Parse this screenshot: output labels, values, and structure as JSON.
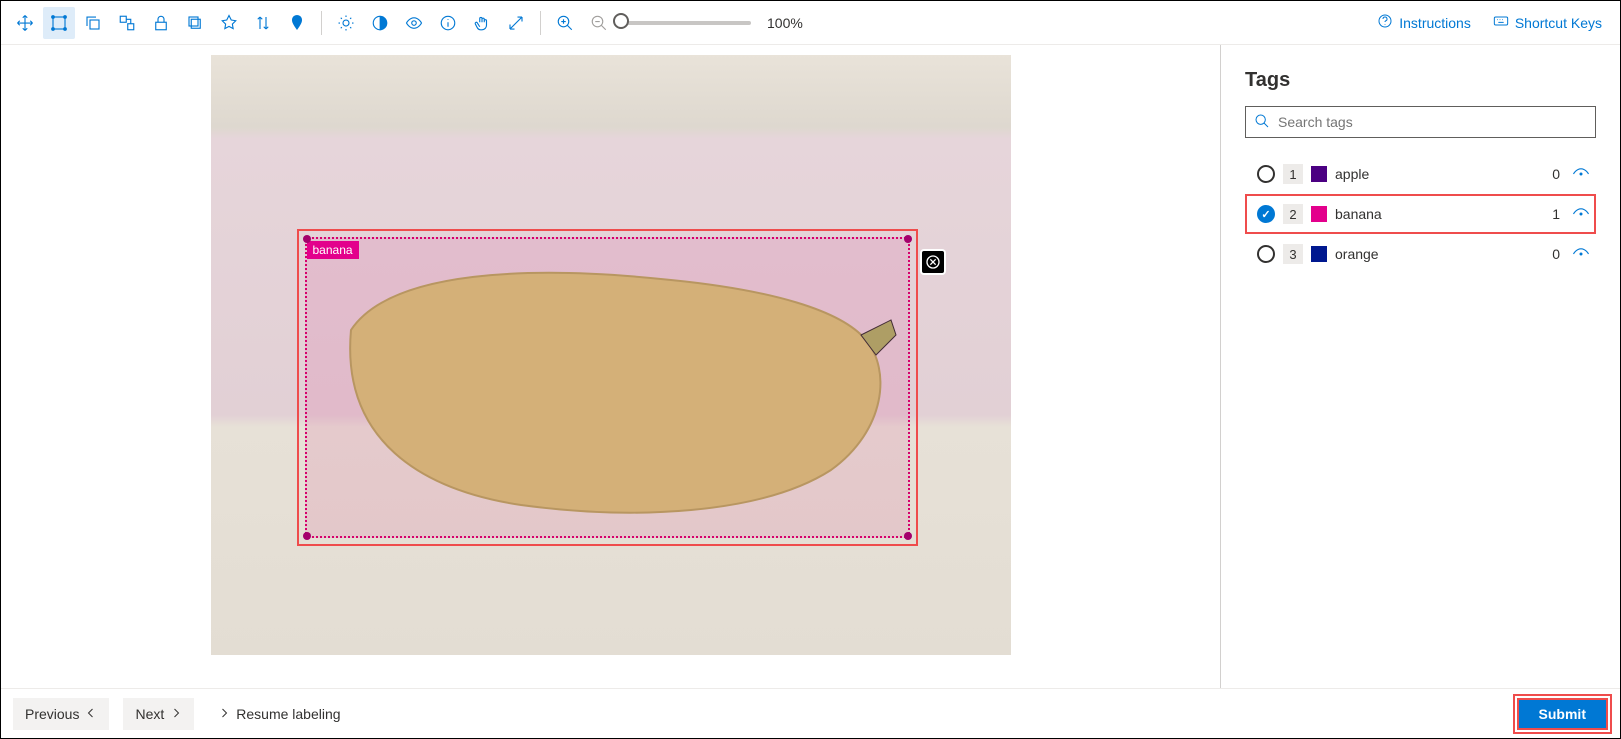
{
  "toolbar": {
    "zoom_level": "100%",
    "instructions_label": "Instructions",
    "shortcut_keys_label": "Shortcut Keys"
  },
  "canvas": {
    "bbox_label": "banana"
  },
  "tags_panel": {
    "title": "Tags",
    "search_placeholder": "Search tags",
    "items": [
      {
        "num": "1",
        "name": "apple",
        "color": "#4b0082",
        "count": "0",
        "checked": false,
        "highlighted": false
      },
      {
        "num": "2",
        "name": "banana",
        "color": "#e3008c",
        "count": "1",
        "checked": true,
        "highlighted": true
      },
      {
        "num": "3",
        "name": "orange",
        "color": "#00188f",
        "count": "0",
        "checked": false,
        "highlighted": false
      }
    ]
  },
  "footer": {
    "previous_label": "Previous",
    "next_label": "Next",
    "resume_label": "Resume labeling",
    "submit_label": "Submit"
  }
}
